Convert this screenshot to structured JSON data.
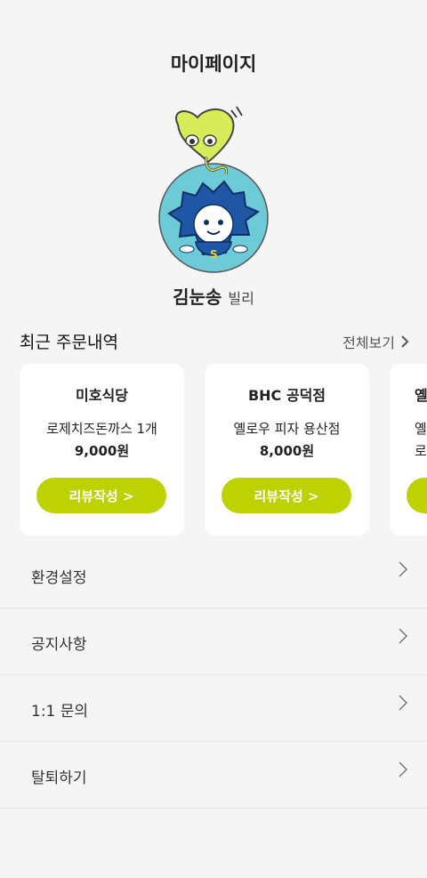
{
  "header": {
    "title": "마이페이지"
  },
  "profile": {
    "name": "김눈송",
    "nickname": "빌리"
  },
  "orders": {
    "title": "최근 주문내역",
    "view_all": "전체보기",
    "cards": [
      {
        "store": "미호식당",
        "menu": "로제치즈돈까스 1개",
        "price": "9,000원",
        "button": "리뷰작성 >"
      },
      {
        "store": "BHC 공덕점",
        "menu": "옐로우 피자 용산점",
        "price": "8,000원",
        "button": "리뷰작성 >"
      },
      {
        "store": "옐",
        "menu": "옐",
        "price": "로",
        "button": ""
      }
    ]
  },
  "menu": {
    "items": [
      {
        "label": "환경설정"
      },
      {
        "label": "공지사항"
      },
      {
        "label": "1:1 문의"
      },
      {
        "label": "탈퇴하기"
      }
    ]
  },
  "colors": {
    "accent": "#bdd200",
    "background": "#f5f5f5",
    "avatar_bg": "#6ccbd6"
  }
}
